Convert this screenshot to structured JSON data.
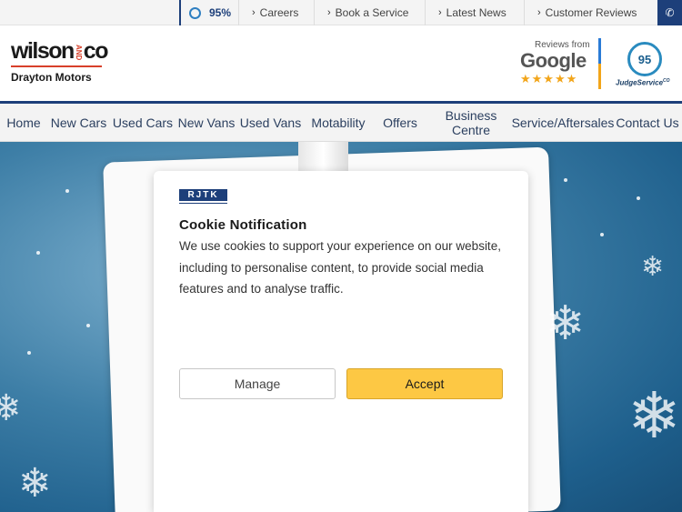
{
  "topbar": {
    "score": "95%",
    "links": [
      {
        "label": "Careers"
      },
      {
        "label": "Book a Service"
      },
      {
        "label": "Latest News"
      },
      {
        "label": "Customer Reviews"
      }
    ],
    "phone_icon": "phone-icon"
  },
  "header": {
    "logo_word": "wilson",
    "logo_and": "AND",
    "logo_co": "co",
    "logo_sub": "Drayton Motors",
    "reviews_from": "Reviews from",
    "google": "Google",
    "google_stars": "★★★★★",
    "judge_score": "95",
    "judge_label": "JudgeService"
  },
  "nav": {
    "items": [
      {
        "label": "Home"
      },
      {
        "label": "New Cars"
      },
      {
        "label": "Used Cars"
      },
      {
        "label": "New Vans"
      },
      {
        "label": "Used Vans"
      },
      {
        "label": "Motability"
      },
      {
        "label": "Offers"
      },
      {
        "label": "Business Centre"
      },
      {
        "label": "Service/Aftersales"
      },
      {
        "label": "Contact Us"
      }
    ]
  },
  "cookie": {
    "brand": "RJTK",
    "title": "Cookie Notification",
    "body": "We use cookies to support your experience on our website, including to personalise content, to provide social media features and to analyse traffic.",
    "manage_label": "Manage",
    "accept_label": "Accept"
  },
  "colors": {
    "brand_navy": "#1d3f7a",
    "accept_yellow": "#fdc844",
    "logo_red": "#d8402a"
  }
}
